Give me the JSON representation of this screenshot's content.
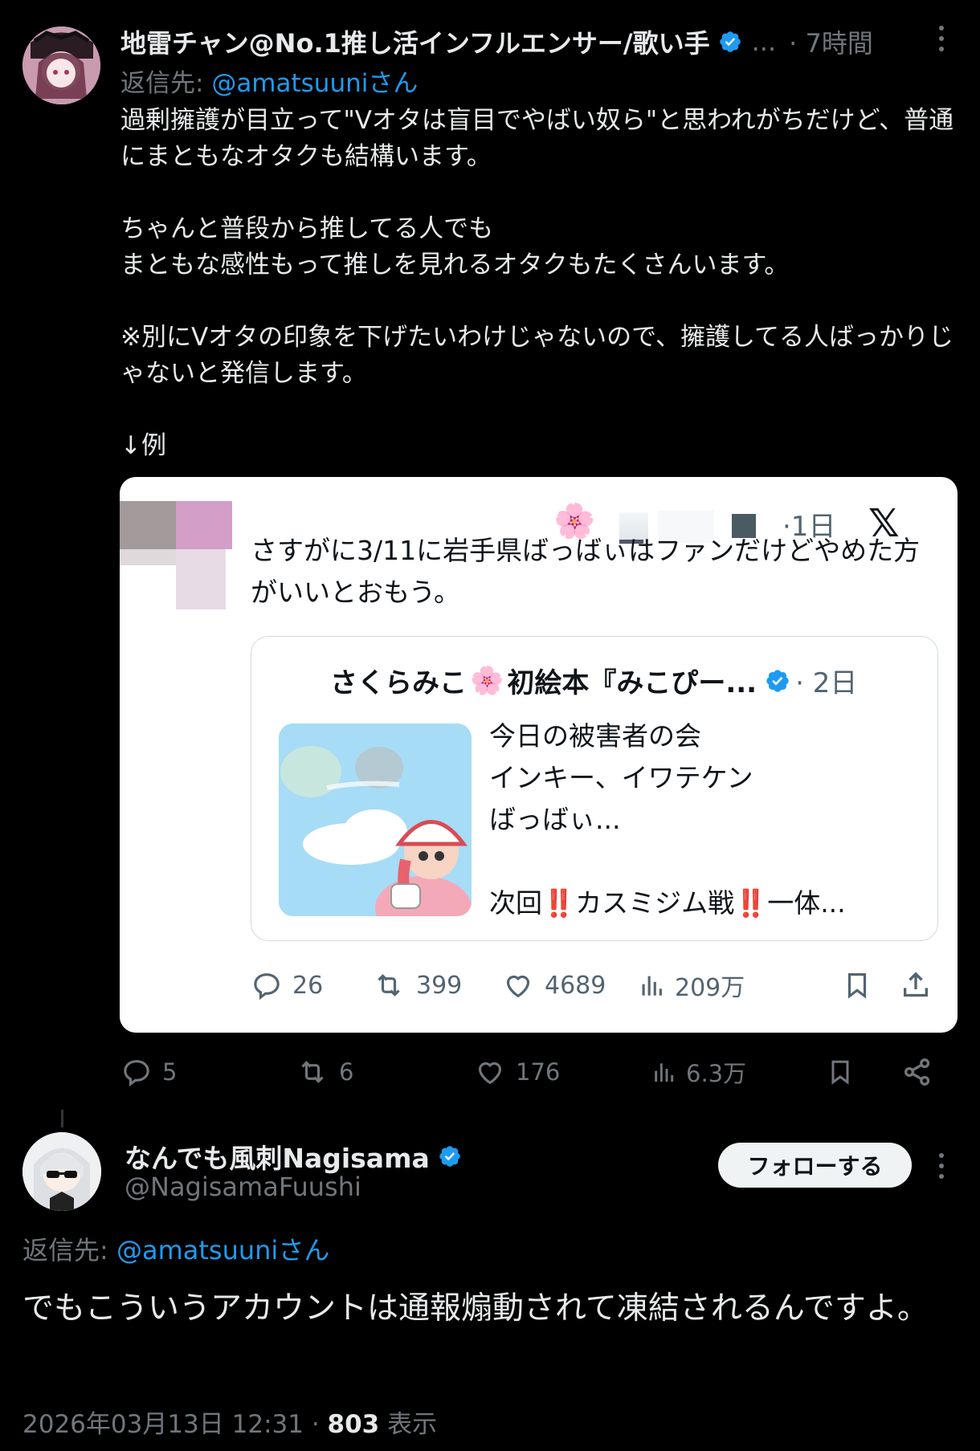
{
  "tweet1": {
    "display_name": "地雷チャン@No.1推し活インフルエンサー/歌い手",
    "name_overflow": "...",
    "time": "· 7時間",
    "reply_prefix": "返信先: ",
    "reply_handle": "@amatsuuni",
    "reply_suffix": "さん",
    "body_paragraphs": [
      "過剰擁護が目立って\"Vオタは盲目でやばい奴ら\"と思われがちだけど、普通にまともなオタクも結構います。",
      "ちゃんと普段から推してる人でも\nまともな感性もって推しを見れるオタクもたくさんいます。",
      "※別にVオタの印象を下げたいわけじゃないので、擁護してる人ばっかりじゃないと発信します。",
      "↓例"
    ],
    "actions": {
      "replies": "5",
      "retweets": "6",
      "likes": "176",
      "views": "6.3万"
    },
    "icons": [
      "reply-icon",
      "retweet-icon",
      "like-icon",
      "views-icon",
      "bookmark-icon",
      "share-icon"
    ]
  },
  "quote_card": {
    "flower": "🌸",
    "time": "·1日",
    "x_logo": "𝕏",
    "text": "さすがに3/11に岩手県ばっばぃはファンだけどやめた方がいいとおもう。",
    "inner": {
      "name_part1": "さくらみこ",
      "flower": "🌸",
      "name_part2": "初絵本『みこぴー...",
      "time": "· 2日",
      "text_lines": [
        "今日の被害者の会",
        "インキー、イワテケン",
        "ばっばぃ..."
      ],
      "last_line_parts": [
        "次回",
        "‼️",
        "カスミジム戦",
        "‼️",
        "一体..."
      ]
    },
    "actions": {
      "replies": "26",
      "retweets": "399",
      "likes": "4689",
      "views": "209万"
    }
  },
  "tweet2": {
    "display_name": "なんでも風刺Nagisama",
    "handle": "@NagisamaFuushi",
    "follow_label": "フォローする",
    "reply_prefix": "返信先: ",
    "reply_handle": "@amatsuuni",
    "reply_suffix": "さん",
    "body": "でもこういうアカウントは通報煽動されて凍結されるんですよ。",
    "timestamp": "2026年03月13日 12:31 · ",
    "views_count": "803",
    "views_label": " 表示"
  },
  "colors": {
    "background": "#000000",
    "text": "#e7e9ea",
    "muted": "#71767b",
    "link": "#1d9bf0",
    "verified": "#1d9bf0",
    "card_bg": "#ffffff",
    "follow_bg": "#eff3f4"
  }
}
